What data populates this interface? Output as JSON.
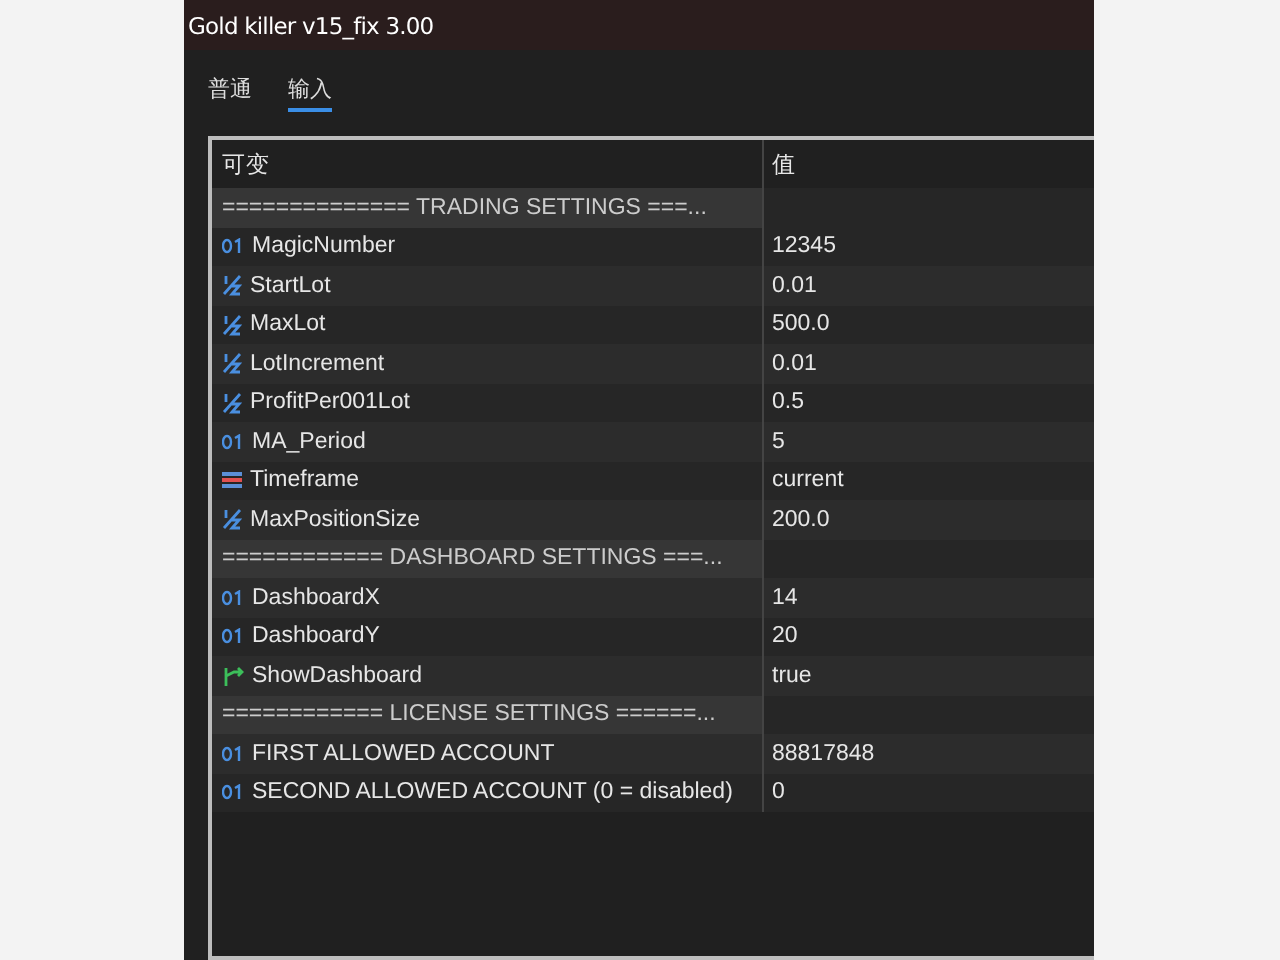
{
  "window": {
    "title": "Gold killer v15_fix 3.00"
  },
  "tabs": [
    {
      "label": "普通",
      "selected": false
    },
    {
      "label": "输入",
      "selected": true
    }
  ],
  "table": {
    "columns": [
      "可变",
      "值"
    ],
    "rows": [
      {
        "kind": "separator",
        "name": "============== TRADING SETTINGS ===..."
      },
      {
        "kind": "int",
        "name": "MagicNumber",
        "value": "12345"
      },
      {
        "kind": "double",
        "name": "StartLot",
        "value": "0.01"
      },
      {
        "kind": "double",
        "name": "MaxLot",
        "value": "500.0"
      },
      {
        "kind": "double",
        "name": "LotIncrement",
        "value": "0.01"
      },
      {
        "kind": "double",
        "name": "ProfitPer001Lot",
        "value": "0.5"
      },
      {
        "kind": "int",
        "name": "MA_Period",
        "value": "5"
      },
      {
        "kind": "enum",
        "name": "Timeframe",
        "value": "current"
      },
      {
        "kind": "double",
        "name": "MaxPositionSize",
        "value": "200.0"
      },
      {
        "kind": "separator",
        "name": "============ DASHBOARD SETTINGS ===..."
      },
      {
        "kind": "int",
        "name": "DashboardX",
        "value": "14"
      },
      {
        "kind": "int",
        "name": "DashboardY",
        "value": "20"
      },
      {
        "kind": "bool",
        "name": "ShowDashboard",
        "value": "true"
      },
      {
        "kind": "separator",
        "name": "============ LICENSE SETTINGS ======..."
      },
      {
        "kind": "int",
        "name": "FIRST ALLOWED ACCOUNT",
        "value": "88817848"
      },
      {
        "kind": "int",
        "name": "SECOND ALLOWED ACCOUNT (0 = disabled)",
        "value": "0"
      }
    ]
  }
}
